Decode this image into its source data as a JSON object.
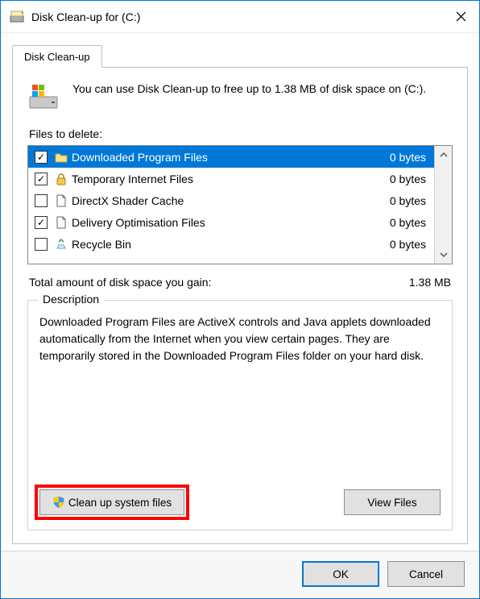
{
  "window_title": "Disk Clean-up for  (C:)",
  "tab_label": "Disk Clean-up",
  "intro_text": "You can use Disk Clean-up to free up to 1.38 MB of disk space on  (C:).",
  "files_label": "Files to delete:",
  "files": [
    {
      "name": "Downloaded Program Files",
      "size": "0 bytes",
      "checked": true,
      "selected": true,
      "icon": "folder"
    },
    {
      "name": "Temporary Internet Files",
      "size": "0 bytes",
      "checked": true,
      "selected": false,
      "icon": "lock"
    },
    {
      "name": "DirectX Shader Cache",
      "size": "0 bytes",
      "checked": false,
      "selected": false,
      "icon": "file"
    },
    {
      "name": "Delivery Optimisation Files",
      "size": "0 bytes",
      "checked": true,
      "selected": false,
      "icon": "file"
    },
    {
      "name": "Recycle Bin",
      "size": "0 bytes",
      "checked": false,
      "selected": false,
      "icon": "recycle"
    }
  ],
  "total_label": "Total amount of disk space you gain:",
  "total_value": "1.38 MB",
  "description_legend": "Description",
  "description_text": "Downloaded Program Files are ActiveX controls and Java applets downloaded automatically from the Internet when you view certain pages. They are temporarily stored in the Downloaded Program Files folder on your hard disk.",
  "clean_system_label": "Clean up system files",
  "view_files_label": "View Files",
  "ok_label": "OK",
  "cancel_label": "Cancel"
}
